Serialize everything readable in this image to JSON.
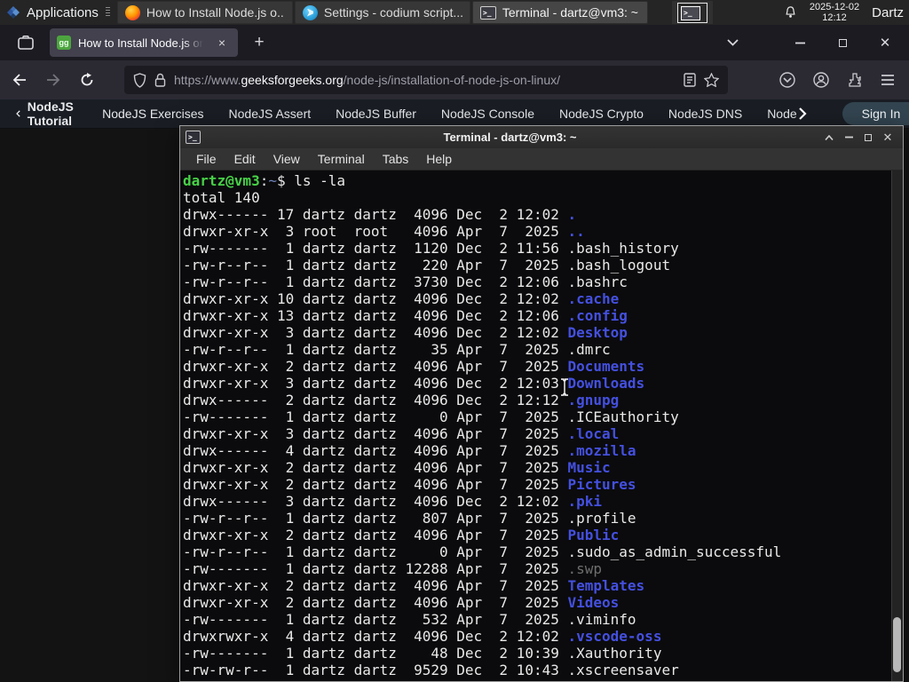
{
  "panel": {
    "applications_label": "Applications",
    "window_buttons": [
      {
        "icon": "firefox",
        "title": "How to Install Node.js o...",
        "active": false
      },
      {
        "icon": "codium",
        "title": "Settings - codium script...",
        "active": false
      },
      {
        "icon": "terminal",
        "title": "Terminal - dartz@vm3: ~",
        "active": true
      }
    ],
    "clock_date": "2025-12-02",
    "clock_time": "12:12",
    "user_label": "Dartz"
  },
  "browser": {
    "tab_title": "How to Install Node.js on",
    "new_tab_label": "+",
    "close_tab_label": "×",
    "url_scheme": "https://www.",
    "url_domain": "geeksforgeeks.org",
    "url_path": "/node-js/installation-of-node-js-on-linux/",
    "favicon_label": "gg"
  },
  "site_nav": {
    "back_item": "NodeJS Tutorial",
    "items": [
      "NodeJS Exercises",
      "NodeJS Assert",
      "NodeJS Buffer",
      "NodeJS Console",
      "NodeJS Crypto",
      "NodeJS DNS"
    ],
    "cut_item": "Node",
    "sign_in_label": "Sign In",
    "accent_green": "#2f8d46"
  },
  "terminal": {
    "title": "Terminal - dartz@vm3: ~",
    "menu_items": [
      "File",
      "Edit",
      "View",
      "Terminal",
      "Tabs",
      "Help"
    ],
    "prompt": {
      "user_host": "dartz@vm3",
      "colon": ":",
      "cwd": "~",
      "rest": "$ ls -la"
    },
    "total_line": "total 140",
    "listing": [
      {
        "perms": "drwx------",
        "links": 17,
        "owner": "dartz",
        "group": "dartz",
        "size": 4096,
        "month": "Dec",
        "day": 2,
        "date": "12:02",
        "name": ".",
        "type": "dir"
      },
      {
        "perms": "drwxr-xr-x",
        "links": 3,
        "owner": "root",
        "group": "root",
        "size": 4096,
        "month": "Apr",
        "day": 7,
        "date": "2025",
        "name": "..",
        "type": "dir"
      },
      {
        "perms": "-rw-------",
        "links": 1,
        "owner": "dartz",
        "group": "dartz",
        "size": 1120,
        "month": "Dec",
        "day": 2,
        "date": "11:56",
        "name": ".bash_history",
        "type": "file"
      },
      {
        "perms": "-rw-r--r--",
        "links": 1,
        "owner": "dartz",
        "group": "dartz",
        "size": 220,
        "month": "Apr",
        "day": 7,
        "date": "2025",
        "name": ".bash_logout",
        "type": "file"
      },
      {
        "perms": "-rw-r--r--",
        "links": 1,
        "owner": "dartz",
        "group": "dartz",
        "size": 3730,
        "month": "Dec",
        "day": 2,
        "date": "12:06",
        "name": ".bashrc",
        "type": "file"
      },
      {
        "perms": "drwxr-xr-x",
        "links": 10,
        "owner": "dartz",
        "group": "dartz",
        "size": 4096,
        "month": "Dec",
        "day": 2,
        "date": "12:02",
        "name": ".cache",
        "type": "dir"
      },
      {
        "perms": "drwxr-xr-x",
        "links": 13,
        "owner": "dartz",
        "group": "dartz",
        "size": 4096,
        "month": "Dec",
        "day": 2,
        "date": "12:06",
        "name": ".config",
        "type": "dir"
      },
      {
        "perms": "drwxr-xr-x",
        "links": 3,
        "owner": "dartz",
        "group": "dartz",
        "size": 4096,
        "month": "Dec",
        "day": 2,
        "date": "12:02",
        "name": "Desktop",
        "type": "dir"
      },
      {
        "perms": "-rw-r--r--",
        "links": 1,
        "owner": "dartz",
        "group": "dartz",
        "size": 35,
        "month": "Apr",
        "day": 7,
        "date": "2025",
        "name": ".dmrc",
        "type": "file"
      },
      {
        "perms": "drwxr-xr-x",
        "links": 2,
        "owner": "dartz",
        "group": "dartz",
        "size": 4096,
        "month": "Apr",
        "day": 7,
        "date": "2025",
        "name": "Documents",
        "type": "dir"
      },
      {
        "perms": "drwxr-xr-x",
        "links": 3,
        "owner": "dartz",
        "group": "dartz",
        "size": 4096,
        "month": "Dec",
        "day": 2,
        "date": "12:03",
        "name": "Downloads",
        "type": "dir"
      },
      {
        "perms": "drwx------",
        "links": 2,
        "owner": "dartz",
        "group": "dartz",
        "size": 4096,
        "month": "Dec",
        "day": 2,
        "date": "12:12",
        "name": ".gnupg",
        "type": "dir"
      },
      {
        "perms": "-rw-------",
        "links": 1,
        "owner": "dartz",
        "group": "dartz",
        "size": 0,
        "month": "Apr",
        "day": 7,
        "date": "2025",
        "name": ".ICEauthority",
        "type": "file"
      },
      {
        "perms": "drwxr-xr-x",
        "links": 3,
        "owner": "dartz",
        "group": "dartz",
        "size": 4096,
        "month": "Apr",
        "day": 7,
        "date": "2025",
        "name": ".local",
        "type": "dir"
      },
      {
        "perms": "drwx------",
        "links": 4,
        "owner": "dartz",
        "group": "dartz",
        "size": 4096,
        "month": "Apr",
        "day": 7,
        "date": "2025",
        "name": ".mozilla",
        "type": "dir"
      },
      {
        "perms": "drwxr-xr-x",
        "links": 2,
        "owner": "dartz",
        "group": "dartz",
        "size": 4096,
        "month": "Apr",
        "day": 7,
        "date": "2025",
        "name": "Music",
        "type": "dir"
      },
      {
        "perms": "drwxr-xr-x",
        "links": 2,
        "owner": "dartz",
        "group": "dartz",
        "size": 4096,
        "month": "Apr",
        "day": 7,
        "date": "2025",
        "name": "Pictures",
        "type": "dir"
      },
      {
        "perms": "drwx------",
        "links": 3,
        "owner": "dartz",
        "group": "dartz",
        "size": 4096,
        "month": "Dec",
        "day": 2,
        "date": "12:02",
        "name": ".pki",
        "type": "dir"
      },
      {
        "perms": "-rw-r--r--",
        "links": 1,
        "owner": "dartz",
        "group": "dartz",
        "size": 807,
        "month": "Apr",
        "day": 7,
        "date": "2025",
        "name": ".profile",
        "type": "file"
      },
      {
        "perms": "drwxr-xr-x",
        "links": 2,
        "owner": "dartz",
        "group": "dartz",
        "size": 4096,
        "month": "Apr",
        "day": 7,
        "date": "2025",
        "name": "Public",
        "type": "dir"
      },
      {
        "perms": "-rw-r--r--",
        "links": 1,
        "owner": "dartz",
        "group": "dartz",
        "size": 0,
        "month": "Apr",
        "day": 7,
        "date": "2025",
        "name": ".sudo_as_admin_successful",
        "type": "file"
      },
      {
        "perms": "-rw-------",
        "links": 1,
        "owner": "dartz",
        "group": "dartz",
        "size": 12288,
        "month": "Apr",
        "day": 7,
        "date": "2025",
        "name": ".swp",
        "type": "dim"
      },
      {
        "perms": "drwxr-xr-x",
        "links": 2,
        "owner": "dartz",
        "group": "dartz",
        "size": 4096,
        "month": "Apr",
        "day": 7,
        "date": "2025",
        "name": "Templates",
        "type": "dir"
      },
      {
        "perms": "drwxr-xr-x",
        "links": 2,
        "owner": "dartz",
        "group": "dartz",
        "size": 4096,
        "month": "Apr",
        "day": 7,
        "date": "2025",
        "name": "Videos",
        "type": "dir"
      },
      {
        "perms": "-rw-------",
        "links": 1,
        "owner": "dartz",
        "group": "dartz",
        "size": 532,
        "month": "Apr",
        "day": 7,
        "date": "2025",
        "name": ".viminfo",
        "type": "file"
      },
      {
        "perms": "drwxrwxr-x",
        "links": 4,
        "owner": "dartz",
        "group": "dartz",
        "size": 4096,
        "month": "Dec",
        "day": 2,
        "date": "12:02",
        "name": ".vscode-oss",
        "type": "dir"
      },
      {
        "perms": "-rw-------",
        "links": 1,
        "owner": "dartz",
        "group": "dartz",
        "size": 48,
        "month": "Dec",
        "day": 2,
        "date": "10:39",
        "name": ".Xauthority",
        "type": "file"
      },
      {
        "perms": "-rw-rw-r--",
        "links": 1,
        "owner": "dartz",
        "group": "dartz",
        "size": 9529,
        "month": "Dec",
        "day": 2,
        "date": "10:43",
        "name": ".xscreensaver",
        "type": "file"
      }
    ]
  }
}
